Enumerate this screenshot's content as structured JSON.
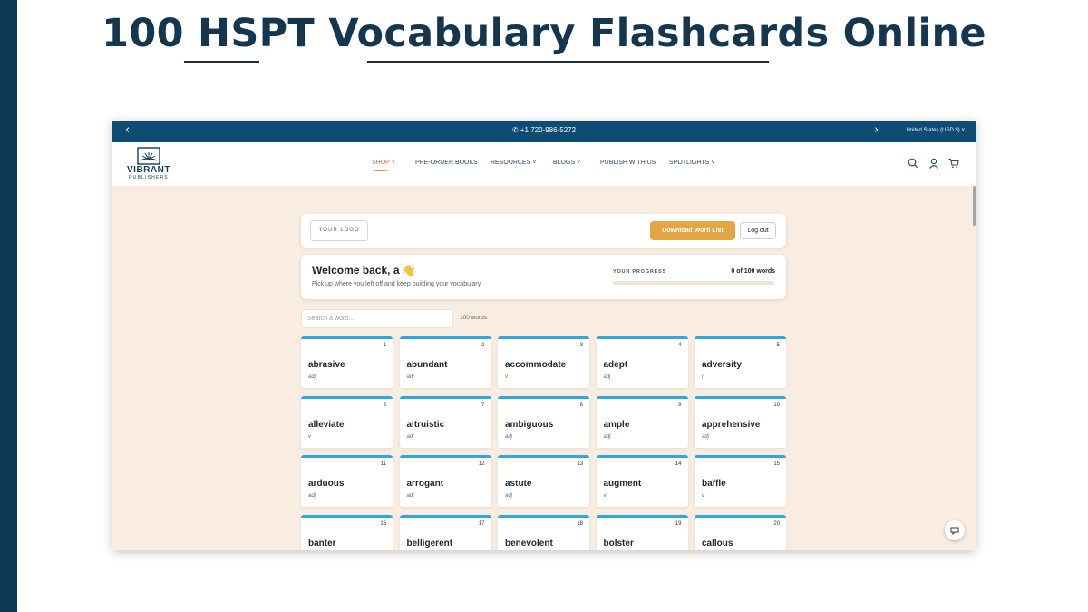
{
  "slide": {
    "title": "100 HSPT Vocabulary Flashcards Online"
  },
  "topbar": {
    "prev_icon": "chevron-left-icon",
    "phone_icon": "phone-icon",
    "phone": "+1 720-986-5272",
    "next_icon": "chevron-right-icon",
    "currency": "United States (USD $)",
    "color": "#0f4c73"
  },
  "nav": {
    "logo_text": "VIBRANT",
    "logo_sub": "PUBLISHERS",
    "items": [
      {
        "label": "SHOP",
        "dropdown": true,
        "active": true
      },
      {
        "label": "PRE-ORDER BOOKS",
        "dropdown": false
      },
      {
        "label": "RESOURCES",
        "dropdown": true
      },
      {
        "label": "BLOGS",
        "dropdown": true
      },
      {
        "label": "PUBLISH WITH US",
        "dropdown": false
      },
      {
        "label": "SPOTLIGHTS",
        "dropdown": true
      }
    ],
    "icons": [
      "search-icon",
      "user-icon",
      "cart-icon"
    ]
  },
  "app": {
    "logo_placeholder": "YOUR LOGO",
    "download_button": "Download Word List",
    "logout_button": "Log out",
    "welcome_title": "Welcome back, a 👋",
    "welcome_sub": "Pick up where you left off and keep building your vocabulary.",
    "progress_label": "YOUR PROGRESS",
    "progress_count": "0 of 100 words",
    "progress_fraction": 0,
    "search_placeholder": "Search a word...",
    "word_count": "100 words",
    "accent": "#e5a545",
    "card_top_color": "#2ea7e0"
  },
  "cards": [
    {
      "num": "1",
      "word": "abrasive",
      "pos": "adj"
    },
    {
      "num": "2",
      "word": "abundant",
      "pos": "adj"
    },
    {
      "num": "3",
      "word": "accommodate",
      "pos": "v"
    },
    {
      "num": "4",
      "word": "adept",
      "pos": "adj"
    },
    {
      "num": "5",
      "word": "adversity",
      "pos": "n"
    },
    {
      "num": "6",
      "word": "alleviate",
      "pos": "v"
    },
    {
      "num": "7",
      "word": "altruistic",
      "pos": "adj"
    },
    {
      "num": "8",
      "word": "ambiguous",
      "pos": "adj"
    },
    {
      "num": "9",
      "word": "ample",
      "pos": "adj"
    },
    {
      "num": "10",
      "word": "apprehensive",
      "pos": "adj"
    },
    {
      "num": "11",
      "word": "arduous",
      "pos": "adj"
    },
    {
      "num": "12",
      "word": "arrogant",
      "pos": "adj"
    },
    {
      "num": "13",
      "word": "astute",
      "pos": "adj"
    },
    {
      "num": "14",
      "word": "augment",
      "pos": "v"
    },
    {
      "num": "15",
      "word": "baffle",
      "pos": "v"
    },
    {
      "num": "16",
      "word": "banter",
      "pos": ""
    },
    {
      "num": "17",
      "word": "belligerent",
      "pos": ""
    },
    {
      "num": "18",
      "word": "benevolent",
      "pos": ""
    },
    {
      "num": "19",
      "word": "bolster",
      "pos": ""
    },
    {
      "num": "20",
      "word": "callous",
      "pos": ""
    }
  ],
  "chat_icon": "chat-icon"
}
